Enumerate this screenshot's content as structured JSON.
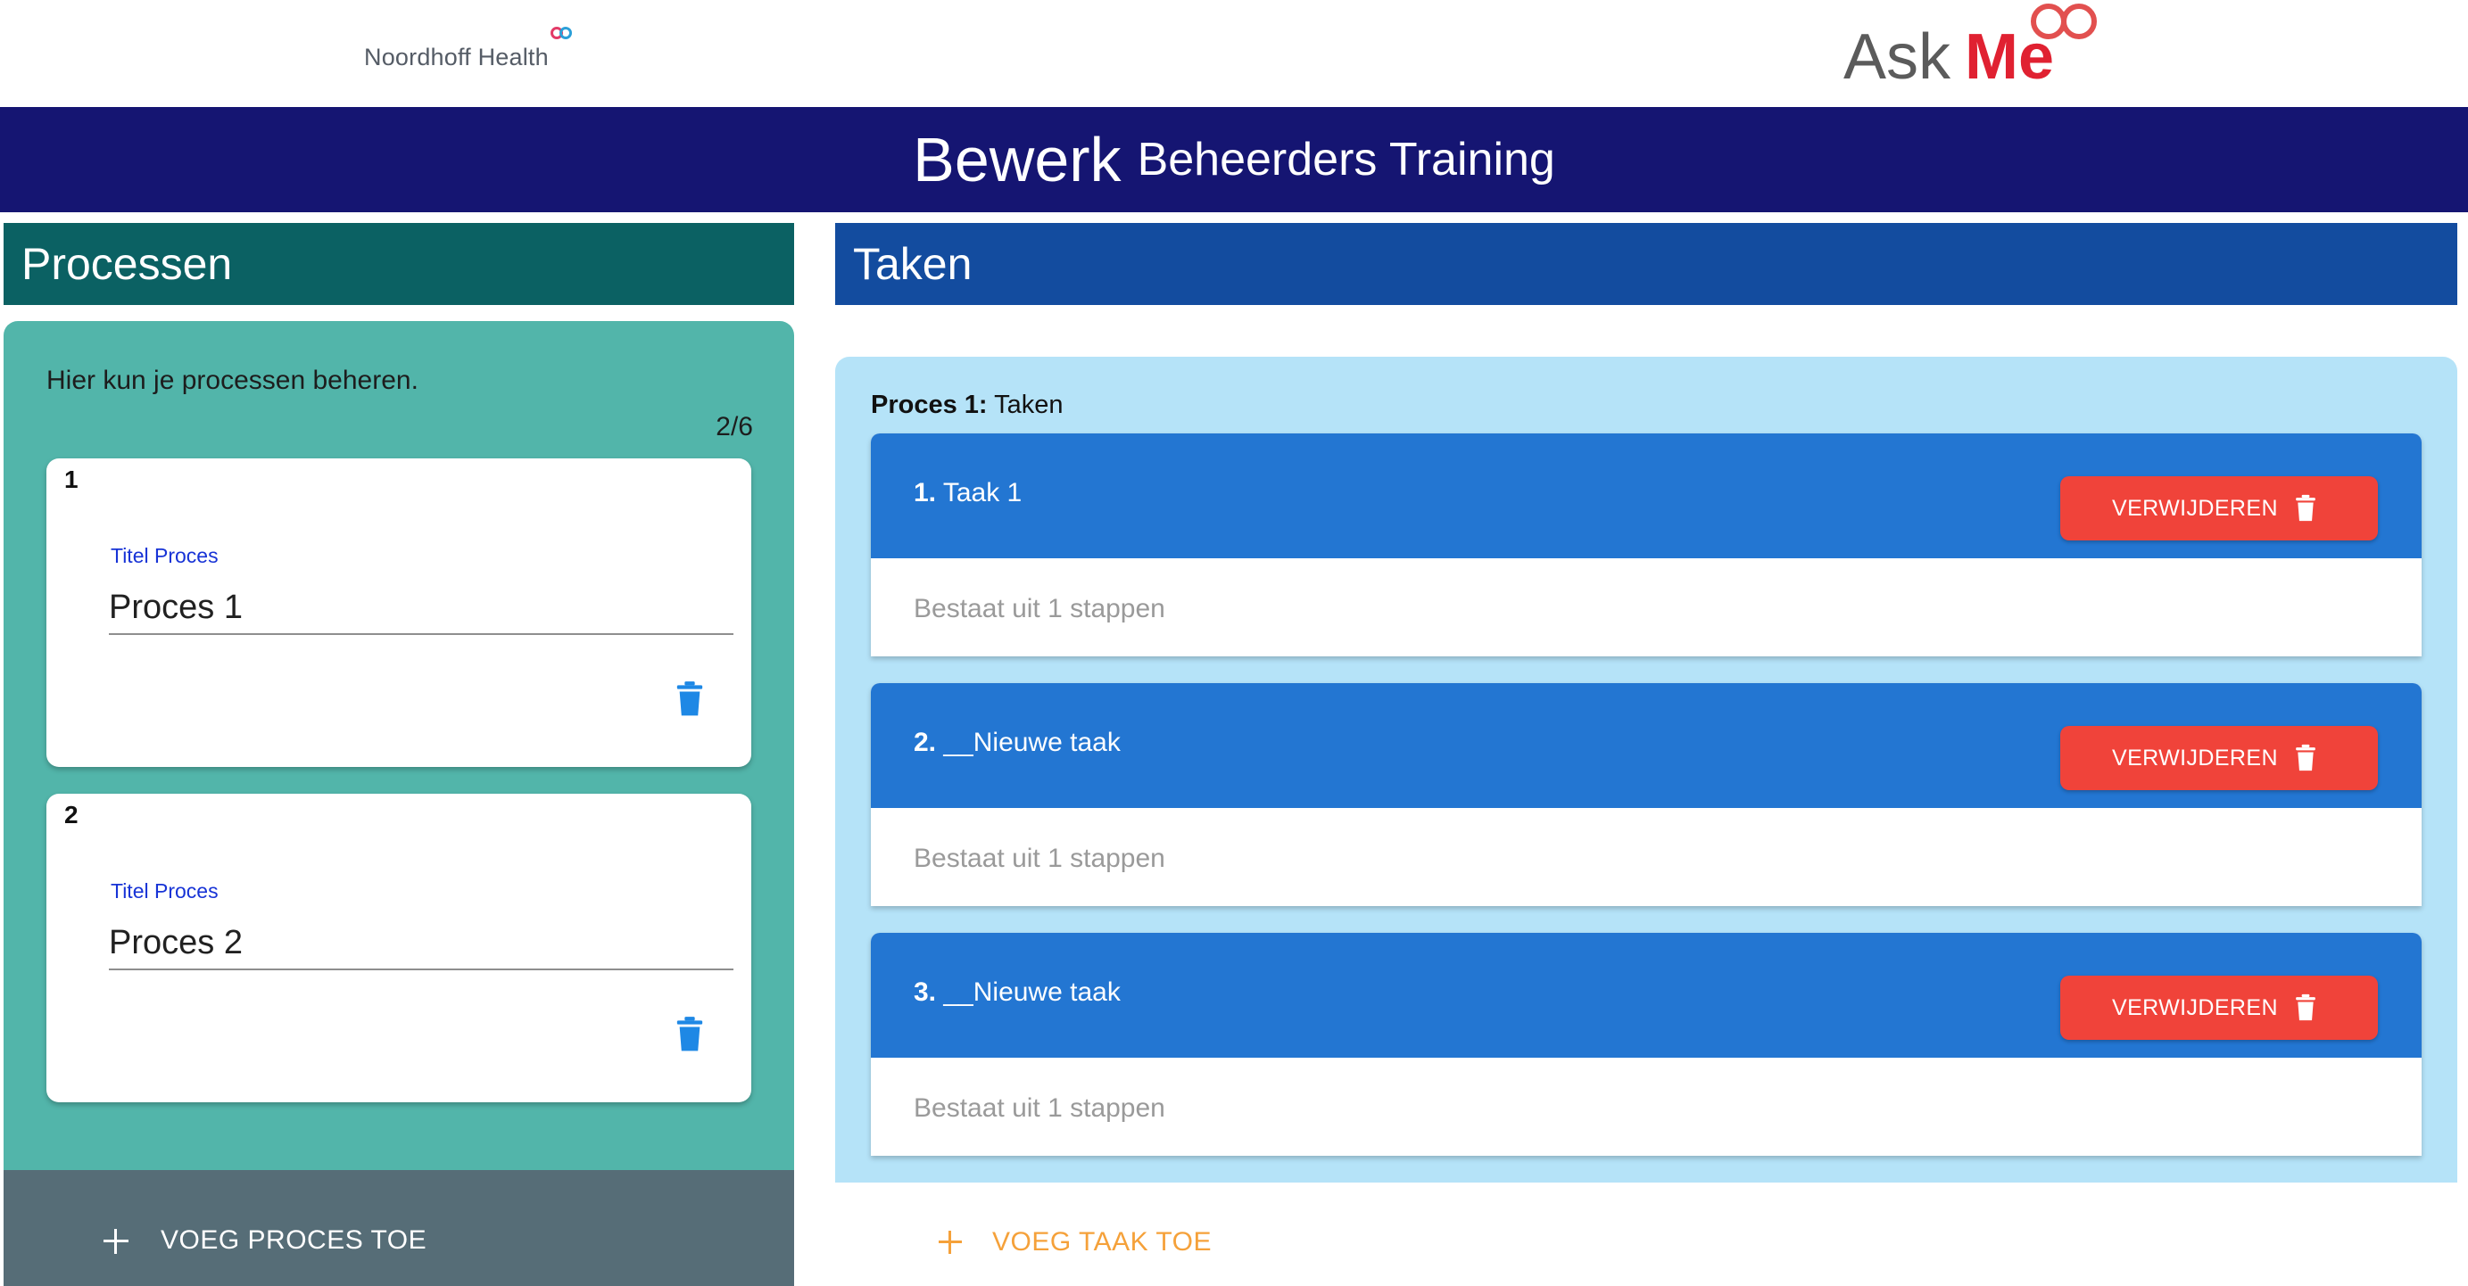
{
  "logos": {
    "noordhoff": "Noordhoff Health",
    "askme_ask": "Ask",
    "askme_me": "Me"
  },
  "header": {
    "title": "Bewerk",
    "subtitle": "Beheerders Training",
    "background": "#151572"
  },
  "processen": {
    "heading": "Processen",
    "intro": "Hier kun je processen beheren.",
    "count": "2/6",
    "cards": [
      {
        "number": "1",
        "field_label": "Titel Proces",
        "value": "Proces 1",
        "delete_icon": "trash-icon"
      },
      {
        "number": "2",
        "field_label": "Titel Proces",
        "value": "Proces 2",
        "delete_icon": "trash-icon"
      }
    ],
    "add_label": "VOEG PROCES TOE",
    "colors": {
      "heading_bg": "#0b6163",
      "panel_bg": "#52b5aa",
      "footer_bg": "#566d77"
    }
  },
  "taken": {
    "heading": "Taken",
    "caption_bold": "Proces 1:",
    "caption_rest": " Taken",
    "tasks": [
      {
        "num": "1.",
        "title": " Taak 1",
        "delete_label": "VERWIJDEREN",
        "description": "Bestaat uit 1 stappen"
      },
      {
        "num": "2.",
        "title": " __Nieuwe taak",
        "delete_label": "VERWIJDEREN",
        "description": "Bestaat uit 1 stappen"
      },
      {
        "num": "3.",
        "title": " __Nieuwe taak",
        "delete_label": "VERWIJDEREN",
        "description": "Bestaat uit 1 stappen"
      }
    ],
    "add_label": "VOEG TAAK TOE",
    "colors": {
      "heading_bg": "#134c9f",
      "panel_bg": "#b5e3f8",
      "task_header_bg": "#2376d2",
      "delete_bg": "#f0433a",
      "add_color": "#f5a13a"
    }
  }
}
